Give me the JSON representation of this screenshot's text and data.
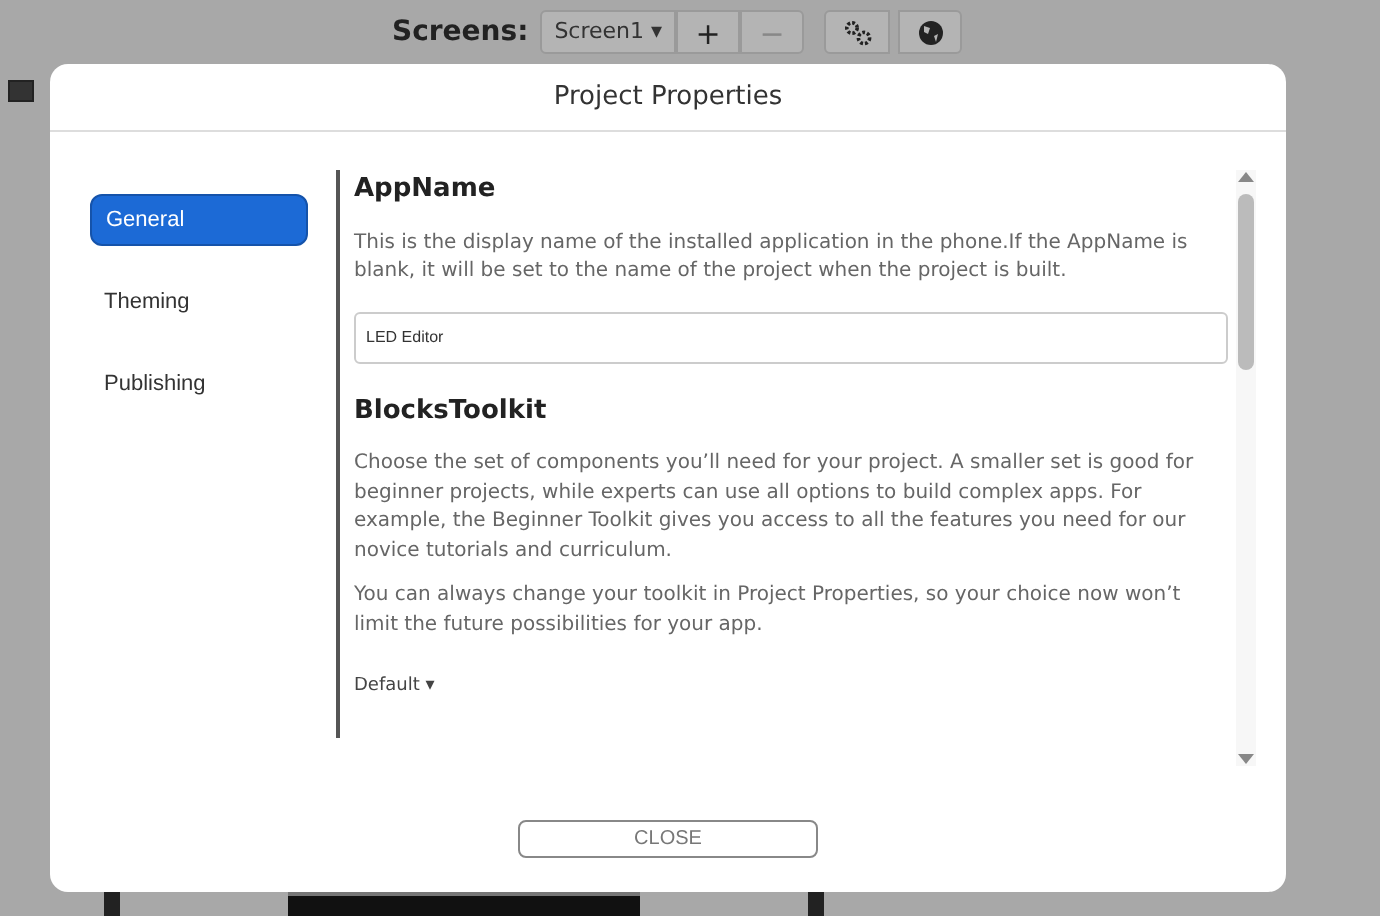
{
  "toolbar": {
    "label": "Screens:",
    "screen_dropdown": "Screen1 ▾",
    "add_button": {
      "label": "+",
      "disabled": false
    },
    "remove_button": {
      "label": "−",
      "disabled": true
    }
  },
  "dialog": {
    "title": "Project Properties",
    "nav": [
      {
        "label": "General",
        "selected": true
      },
      {
        "label": "Theming",
        "selected": false
      },
      {
        "label": "Publishing",
        "selected": false
      }
    ],
    "sections": [
      {
        "kind": "text_field",
        "heading": "AppName",
        "paragraphs": [
          "This is the display name of the installed application in the phone.If the AppName is blank, it will be set to the name of the project when the project is built."
        ],
        "value": "LED Editor"
      },
      {
        "kind": "dropdown",
        "heading": "BlocksToolkit",
        "paragraphs": [
          "Choose the set of components you’ll need for your project. A smaller set is good for beginner projects, while experts can use all options to build complex apps. For example, the Beginner Toolkit gives you access to all the features you need for our novice tutorials and curriculum.",
          "You can always change your toolkit in Project Properties, so your choice now won’t limit the future possibilities for your app."
        ],
        "value": "Default ▾"
      }
    ],
    "close_button": "CLOSE"
  }
}
